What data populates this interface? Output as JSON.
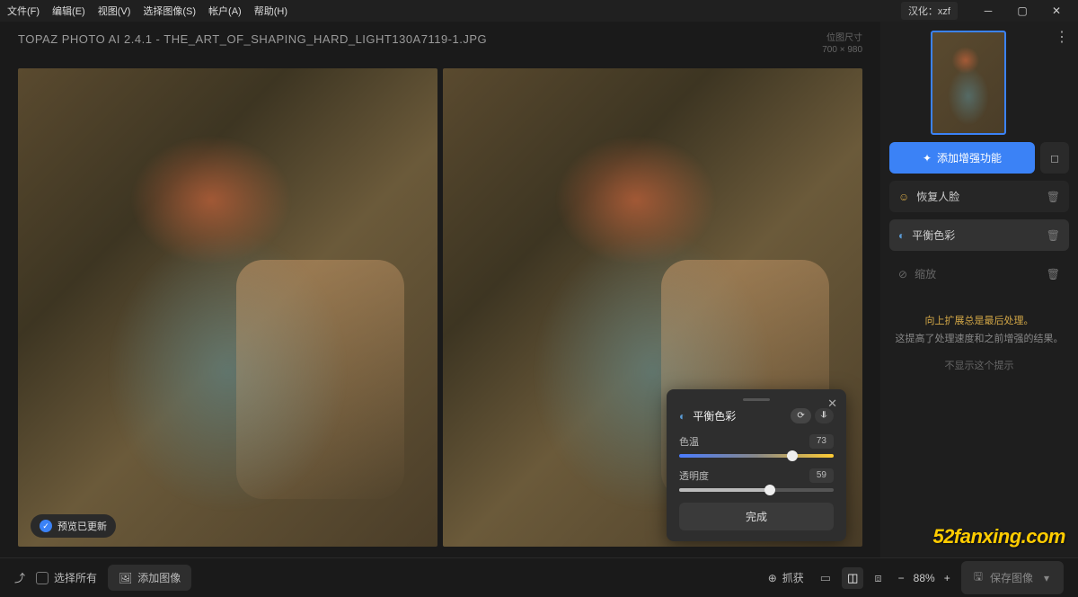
{
  "menu": [
    "文件(F)",
    "编辑(E)",
    "视图(V)",
    "选择图像(S)",
    "帐户(A)",
    "帮助(H)"
  ],
  "win": {
    "badge": "汉化：xzf"
  },
  "header": {
    "title": "TOPAZ PHOTO AI 2.4.1 - THE_ART_OF_SHAPING_HARD_LIGHT130A7119-1.JPG",
    "dim_label": "位图尺寸",
    "dim_value": "700 × 980"
  },
  "preview_badge": "预览已更新",
  "popup": {
    "title": "平衡色彩",
    "sliders": [
      {
        "label": "色温",
        "value": 73
      },
      {
        "label": "透明度",
        "value": 59
      }
    ],
    "done": "完成"
  },
  "sidebar": {
    "add": "添加增强功能",
    "items": [
      {
        "icon": "face",
        "label": "恢复人脸",
        "active": false
      },
      {
        "icon": "balance",
        "label": "平衡色彩",
        "active": true
      },
      {
        "icon": "eye-off",
        "label": "缩放",
        "active": false,
        "muted": true
      }
    ],
    "tip": {
      "title": "向上扩展总是最后处理。",
      "body": "这提高了处理速度和之前增强的结果。",
      "dismiss": "不显示这个提示"
    }
  },
  "bottom": {
    "select_all": "选择所有",
    "add_image": "添加图像",
    "capture": "抓获",
    "zoom": "88%",
    "save": "保存图像"
  },
  "watermark": "52fanxing.com"
}
